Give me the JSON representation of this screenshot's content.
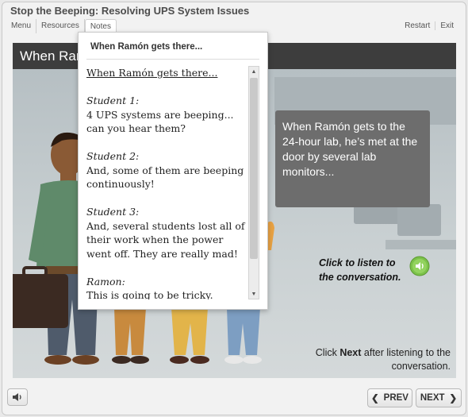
{
  "course_title": "Stop the Beeping: Resolving UPS System Issues",
  "nav": {
    "menu": "Menu",
    "resources": "Resources",
    "notes": "Notes",
    "restart": "Restart",
    "exit": "Exit"
  },
  "slide": {
    "title": "When Ramón gets there...",
    "caption": "When Ramón gets to the 24-hour lab, he’s met at the door by several lab monitors...",
    "listen_line1": "Click to listen to",
    "listen_line2": "the conversation.",
    "instruction_pre": "Click ",
    "instruction_bold": "Next",
    "instruction_post": " after listening to the conversation."
  },
  "notes": {
    "heading": "When Ramón gets there...",
    "title_line": "When Ramón gets there...",
    "entries": [
      {
        "speaker": "Student 1:",
        "text": "4 UPS systems are beeping... can you hear them?"
      },
      {
        "speaker": "Student 2:",
        "text": "And, some of them are beeping continuously!"
      },
      {
        "speaker": "Student 3:",
        "text": "And, several students lost all of their work when the power went off.  They are really mad!"
      },
      {
        "speaker": "Ramon:",
        "text": "This is going to be tricky."
      }
    ]
  },
  "controls": {
    "prev": "PREV",
    "next": "NEXT"
  },
  "icons": {
    "volume": "speaker-icon",
    "audio": "audio-play-icon",
    "prev": "chevron-left-icon",
    "next": "chevron-right-icon"
  },
  "colors": {
    "header_bg": "#3d3d3d",
    "caption_bg": "#6d6d6d",
    "audio_green": "#7cc24a"
  }
}
